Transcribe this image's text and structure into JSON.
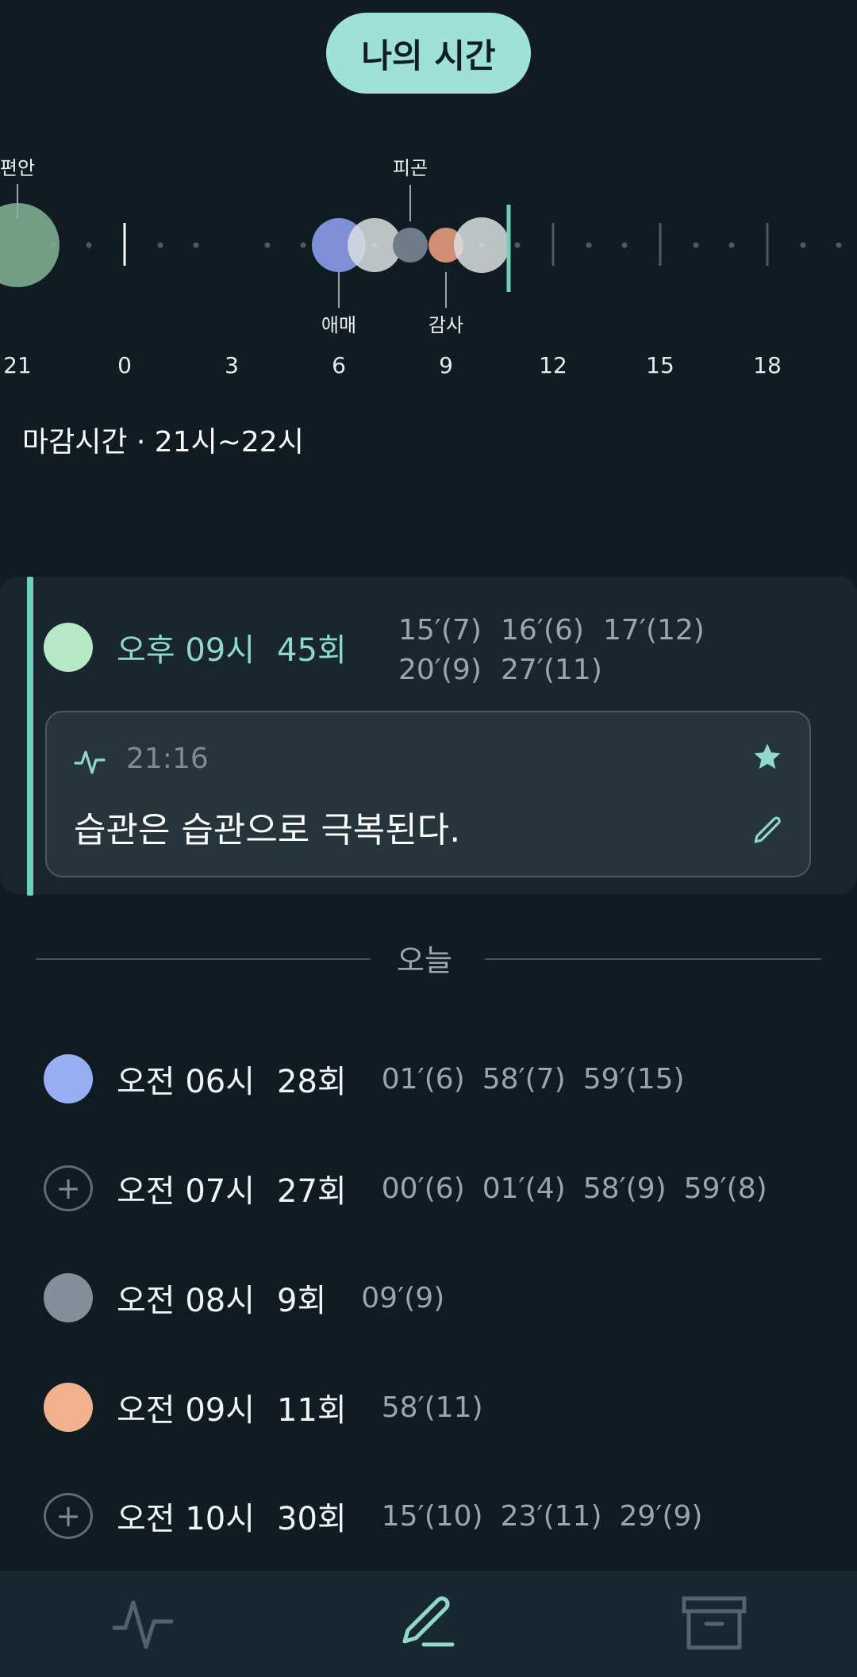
{
  "header": {
    "title": "나의 시간"
  },
  "timeline": {
    "tick_labels": [
      "21",
      "0",
      "3",
      "6",
      "9",
      "12",
      "15",
      "18"
    ],
    "labels": {
      "comfort": "편안",
      "fatigue": "피곤",
      "ambiguous": "애매",
      "thanks": "감사"
    }
  },
  "deadline": "마감시간 · 21시~22시",
  "focus": {
    "time": "오후 09시",
    "count": "45회",
    "minutes": [
      "15′(7)",
      "16′(6)",
      "17′(12)",
      "20′(9)",
      "27′(11)"
    ],
    "dot_color": "#b5e8c4",
    "memo": {
      "time": "21:16",
      "text": "습관은 습관으로 극복된다."
    }
  },
  "today_label": "오늘",
  "rows": [
    {
      "time": "오전 06시",
      "count": "28회",
      "minutes": [
        "01′(6)",
        "58′(7)",
        "59′(15)"
      ],
      "marker": "dot",
      "color": "#98aef5"
    },
    {
      "time": "오전 07시",
      "count": "27회",
      "minutes": [
        "00′(6)",
        "01′(4)",
        "58′(9)",
        "59′(8)"
      ],
      "marker": "plus",
      "plus_glyph": "+"
    },
    {
      "time": "오전 08시",
      "count": "9회",
      "minutes": [
        "09′(9)"
      ],
      "marker": "dot",
      "color": "#858f9a"
    },
    {
      "time": "오전 09시",
      "count": "11회",
      "minutes": [
        "58′(11)"
      ],
      "marker": "dot",
      "color": "#f2b18e"
    },
    {
      "time": "오전 10시",
      "count": "30회",
      "minutes": [
        "15′(10)",
        "23′(11)",
        "29′(9)"
      ],
      "marker": "plus",
      "plus_glyph": "+"
    }
  ],
  "nav": {
    "items": [
      "activity-icon",
      "pencil-icon",
      "archive-icon"
    ]
  },
  "colors": {
    "accent": "#8fd9c6",
    "background": "#111b22",
    "pill": "#9fe1d4"
  }
}
